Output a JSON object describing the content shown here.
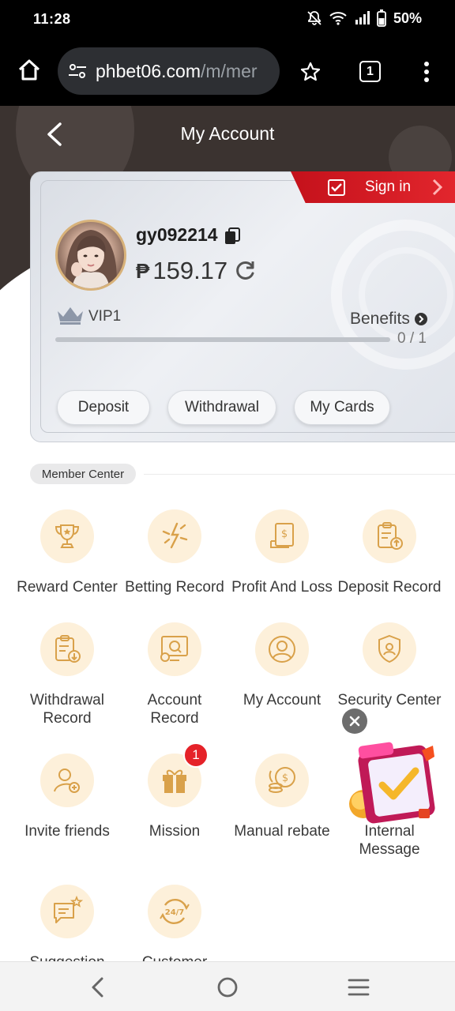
{
  "statusbar": {
    "time": "11:28",
    "battery": "50%"
  },
  "browser": {
    "url_main": "phbet06.com",
    "url_rest": "/m/mer",
    "tab_count": "1"
  },
  "header": {
    "title": "My Account"
  },
  "signin": {
    "label": "Sign in"
  },
  "account": {
    "username": "gy092214",
    "currency_symbol": "₱",
    "balance": "159.17",
    "vip_level": "VIP1",
    "benefits_label": "Benefits",
    "progress_text": "0 / 1",
    "progress_fraction": 0.0,
    "buttons": {
      "deposit": "Deposit",
      "withdrawal": "Withdrawal",
      "my_cards": "My Cards"
    }
  },
  "member_center": {
    "tag": "Member Center",
    "items": [
      {
        "label": "Reward Center",
        "icon": "trophy-icon"
      },
      {
        "label": "Betting Record",
        "icon": "lightning-icon"
      },
      {
        "label": "Profit And Loss",
        "icon": "receipt-icon"
      },
      {
        "label": "Deposit Record",
        "icon": "clipboard-upload-icon"
      },
      {
        "label": "Withdrawal\nRecord",
        "icon": "clipboard-download-icon"
      },
      {
        "label": "Account\nRecord",
        "icon": "monitor-search-icon"
      },
      {
        "label": "My Account",
        "icon": "user-circle-icon"
      },
      {
        "label": "Security Center",
        "icon": "shield-user-icon"
      },
      {
        "label": "Invite friends",
        "icon": "user-add-icon"
      },
      {
        "label": "Mission",
        "icon": "gift-icon"
      },
      {
        "label": "Manual rebate",
        "icon": "coins-icon"
      },
      {
        "label": "Internal\nMessage",
        "icon": "message-icon"
      },
      {
        "label": "Suggestion",
        "icon": "chat-star-icon"
      },
      {
        "label": "Customer",
        "icon": "support-247-icon"
      }
    ],
    "mission_badge": "1"
  },
  "colors": {
    "accent_red": "#e2262d",
    "icon_bg": "#fdf0da",
    "icon_stroke": "#d9a14a",
    "header_bg": "#3b3330"
  }
}
